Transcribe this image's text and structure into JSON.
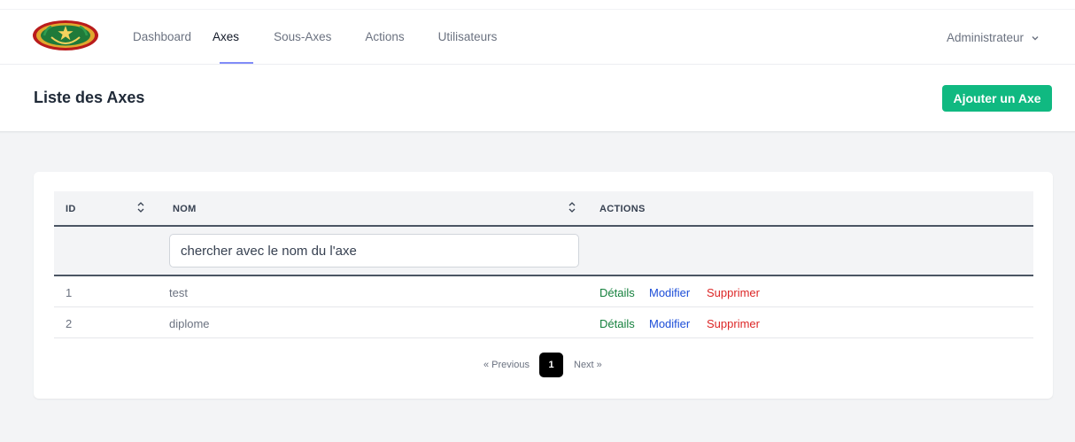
{
  "nav": {
    "items": [
      {
        "label": "Dashboard",
        "active": false
      },
      {
        "label": "Axes",
        "active": true
      },
      {
        "label": "Sous-Axes",
        "active": false
      },
      {
        "label": "Actions",
        "active": false
      },
      {
        "label": "Utilisateurs",
        "active": false
      }
    ],
    "user_label": "Administrateur"
  },
  "page": {
    "title": "Liste des Axes",
    "add_button_label": "Ajouter un Axe"
  },
  "table": {
    "headers": {
      "id": "ID",
      "name": "NOM",
      "actions": "ACTIONS"
    },
    "search_placeholder": "chercher avec le nom du l'axe",
    "rows": [
      {
        "id": "1",
        "name": "test",
        "details": "Détails",
        "modify": "Modifier",
        "delete": "Supprimer"
      },
      {
        "id": "2",
        "name": "diplome",
        "details": "Détails",
        "modify": "Modifier",
        "delete": "Supprimer"
      }
    ]
  },
  "pagination": {
    "previous": "« Previous",
    "current": "1",
    "next": "Next »"
  },
  "colors": {
    "accent": "#10b981",
    "details": "#15803d",
    "modify": "#1d4ed8",
    "delete": "#dc2626",
    "nav_underline": "#818cf8"
  },
  "icons": {
    "logo": "national-emblem-logo",
    "sort": "sort-updown-icon",
    "user_menu": "chevron-down-icon"
  }
}
